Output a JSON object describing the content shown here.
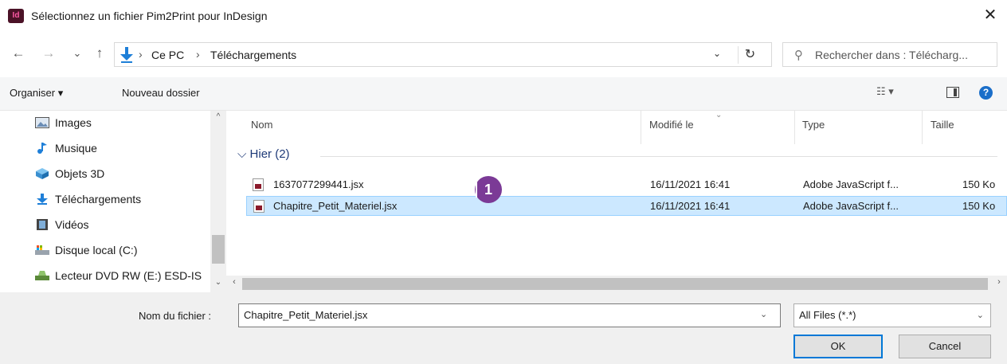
{
  "window": {
    "app_icon_text": "Id",
    "title": "Sélectionnez un fichier Pim2Print pour InDesign",
    "close_glyph": "✕"
  },
  "nav": {
    "back_glyph": "←",
    "forward_glyph": "→",
    "recent_glyph": "⌄",
    "up_glyph": "↑"
  },
  "address": {
    "crumbs": [
      "Ce PC",
      "Téléchargements"
    ],
    "separator": "›",
    "dropdown_glyph": "⌄",
    "refresh_glyph": "↻"
  },
  "search": {
    "placeholder": "Rechercher dans : Télécharg..."
  },
  "toolbar": {
    "organize_label": "Organiser ▾",
    "new_folder_label": "Nouveau dossier",
    "view_glyph": "☷ ▾",
    "help_glyph": "?"
  },
  "sidebar": {
    "items": [
      {
        "label": "Images",
        "icon": "images-icon"
      },
      {
        "label": "Musique",
        "icon": "music-icon"
      },
      {
        "label": "Objets 3D",
        "icon": "objects-3d-icon"
      },
      {
        "label": "Téléchargements",
        "icon": "downloads-icon"
      },
      {
        "label": "Vidéos",
        "icon": "videos-icon"
      },
      {
        "label": "Disque local (C:)",
        "icon": "local-disk-icon"
      },
      {
        "label": "Lecteur DVD RW (E:) ESD-IS",
        "icon": "dvd-drive-icon"
      }
    ],
    "scroll_up_glyph": "^",
    "scroll_down_glyph": "⌄"
  },
  "filelist": {
    "columns": [
      "Nom",
      "Modifié le",
      "Type",
      "Taille"
    ],
    "sort_glyph": "⌄",
    "group_label": "⌵ Hier (2)",
    "rows": [
      {
        "name": "1637077299441.jsx",
        "modified": "16/11/2021 16:41",
        "type": "Adobe JavaScript f...",
        "size": "150 Ko",
        "selected": false
      },
      {
        "name": "Chapitre_Petit_Materiel.jsx",
        "modified": "16/11/2021 16:41",
        "type": "Adobe JavaScript f...",
        "size": "150 Ko",
        "selected": true
      }
    ],
    "annotation_badge": "1",
    "hscroll_left_glyph": "‹",
    "hscroll_right_glyph": "›"
  },
  "footer": {
    "filename_label": "Nom du fichier :",
    "filename_value": "Chapitre_Petit_Materiel.jsx",
    "filename_dd_glyph": "⌄",
    "filetype_value": "All Files (*.*)",
    "filetype_dd_glyph": "⌄",
    "ok_label": "OK",
    "cancel_label": "Cancel"
  },
  "colors": {
    "selection_bg": "#cce8ff",
    "selection_border": "#99d1ff",
    "badge": "#7b3a96",
    "indesign_brand": "#4b1227",
    "primary_button_border": "#0078d7"
  }
}
